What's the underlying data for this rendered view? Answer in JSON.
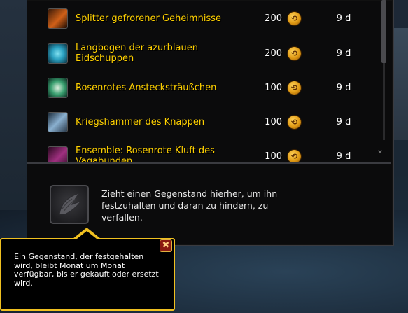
{
  "items": [
    {
      "name": "Splitter gefrorener Geheimnisse",
      "price": "200",
      "days": "9 d",
      "icon": "frost-shard-icon",
      "icon_color": "#d06018"
    },
    {
      "name": "Langbogen der azurblauen Eidschuppen",
      "price": "200",
      "days": "9 d",
      "icon": "azure-longbow-icon",
      "icon_color": "#2aa0c0"
    },
    {
      "name": "Rosenrotes Anstecksträußchen",
      "price": "100",
      "days": "9 d",
      "icon": "rose-corsage-icon",
      "icon_color": "#3aa070"
    },
    {
      "name": "Kriegshammer des Knappen",
      "price": "100",
      "days": "9 d",
      "icon": "warhammer-icon",
      "icon_color": "#8ab0d0"
    },
    {
      "name": "Ensemble: Rosenrote Kluft des Vagabunden",
      "price": "100",
      "days": "9 d",
      "icon": "ensemble-icon",
      "icon_color": "#a03080"
    }
  ],
  "currency_icon": "trader-tender-coin-icon",
  "drop_slot": {
    "text": "Zieht einen Gegenstand hierher, um ihn festzuhalten und daran zu hindern, zu verfallen.",
    "icon": "wing-emblem-icon"
  },
  "tooltip": {
    "text": "Ein Gegenstand, der festgehalten wird, bleibt Monat um Monat verfügbar, bis er gekauft oder ersetzt wird.",
    "close_label": "✖"
  },
  "colors": {
    "item_name": "#ffd100",
    "tooltip_border": "#f0c020"
  }
}
